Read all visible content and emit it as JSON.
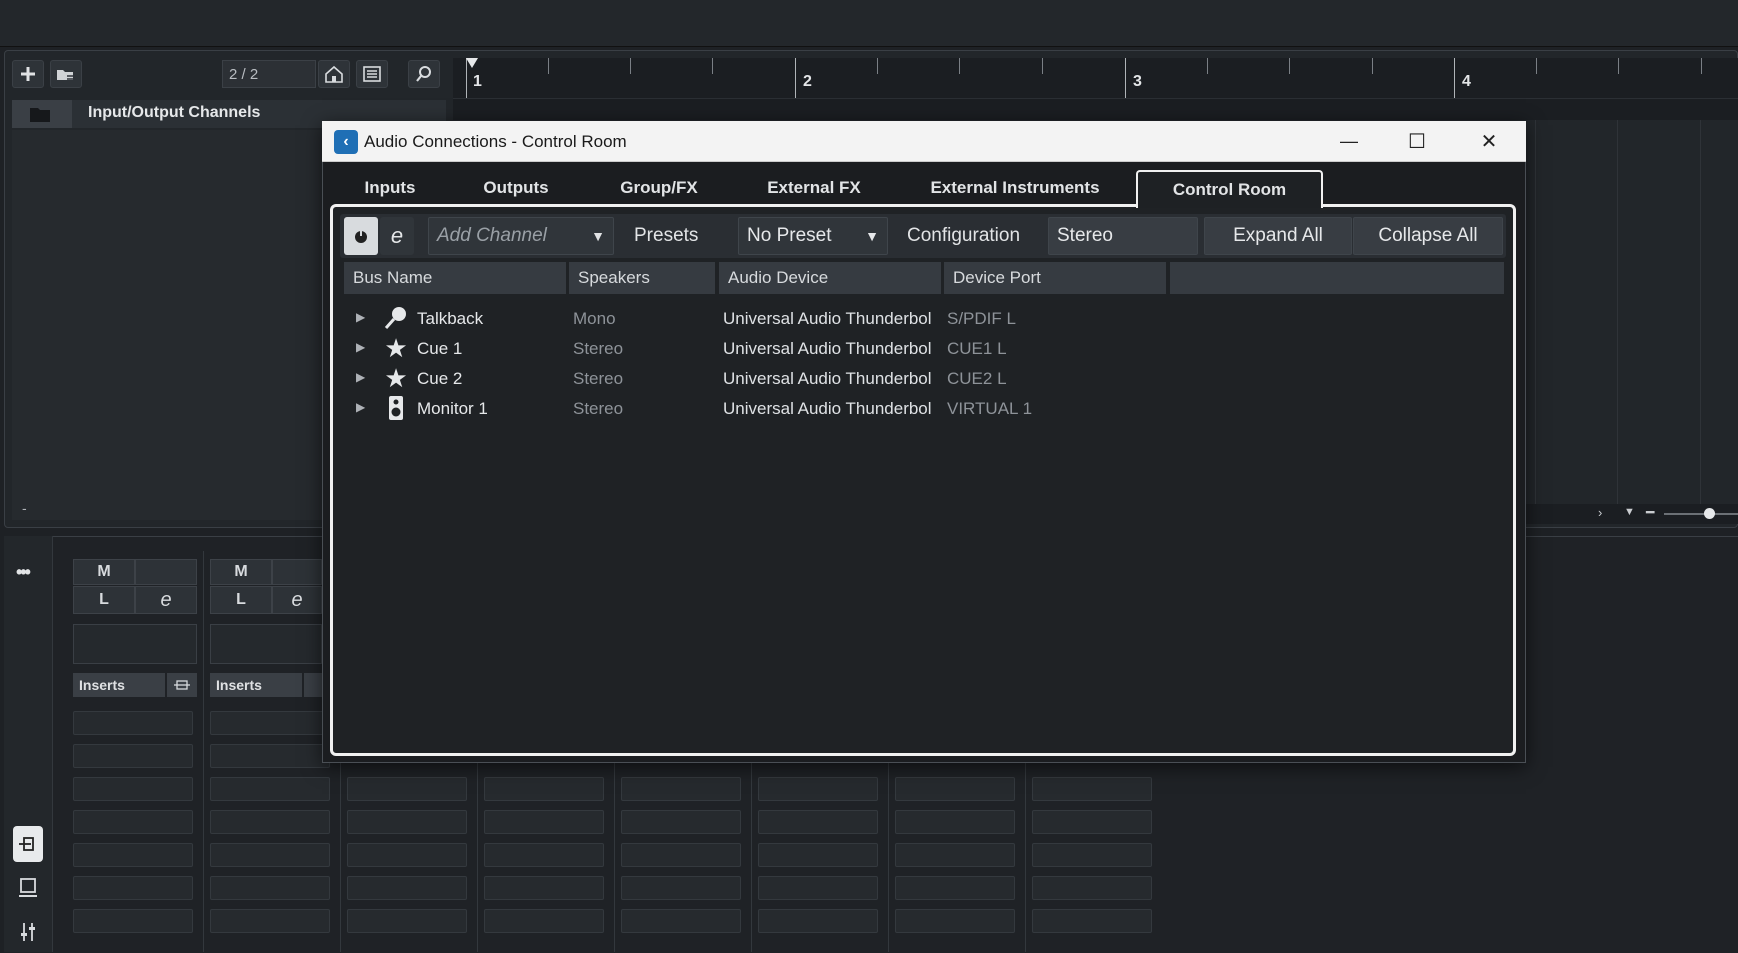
{
  "project": {
    "track_count": "2 / 2",
    "track_folder_name": "Input/Output Channels",
    "ruler_bars": [
      "1",
      "2",
      "3",
      "4"
    ],
    "tracklist_footer": "-"
  },
  "mixer": {
    "menu_label": "•••",
    "strips": [
      {
        "mute": "M",
        "listen": "L",
        "edit": "e",
        "inserts_label": "Inserts"
      },
      {
        "mute": "M",
        "listen": "L",
        "edit": "e",
        "inserts_label": "Inserts"
      }
    ]
  },
  "dialog": {
    "title": "Audio Connections - Control Room",
    "window_controls": {
      "minimize": "—",
      "maximize": "☐",
      "close": "✕"
    },
    "tabs": [
      {
        "label": "Inputs",
        "active": false
      },
      {
        "label": "Outputs",
        "active": false
      },
      {
        "label": "Group/FX",
        "active": false
      },
      {
        "label": "External FX",
        "active": false
      },
      {
        "label": "External Instruments",
        "active": false
      },
      {
        "label": "Control Room",
        "active": true
      }
    ],
    "toolbar": {
      "add_channel": "Add Channel",
      "presets_label": "Presets",
      "preset_value": "No Preset",
      "configuration_label": "Configuration",
      "configuration_value": "Stereo",
      "expand_all": "Expand All",
      "collapse_all": "Collapse All"
    },
    "columns": [
      "Bus Name",
      "Speakers",
      "Audio Device",
      "Device Port",
      ""
    ],
    "rows": [
      {
        "icon": "microphone-icon",
        "name": "Talkback",
        "speakers": "Mono",
        "device": "Universal Audio Thunderbol",
        "port": "S/PDIF L"
      },
      {
        "icon": "star-icon",
        "name": "Cue 1",
        "speakers": "Stereo",
        "device": "Universal Audio Thunderbol",
        "port": "CUE1 L"
      },
      {
        "icon": "star-icon",
        "name": "Cue 2",
        "speakers": "Stereo",
        "device": "Universal Audio Thunderbol",
        "port": "CUE2 L"
      },
      {
        "icon": "speaker-icon",
        "name": "Monitor 1",
        "speakers": "Stereo",
        "device": "Universal Audio Thunderbol",
        "port": "VIRTUAL 1"
      }
    ]
  },
  "colors": {
    "accent": "#1f6fb5",
    "panel_border": "#f1f1f1",
    "background": "#1e2125"
  }
}
